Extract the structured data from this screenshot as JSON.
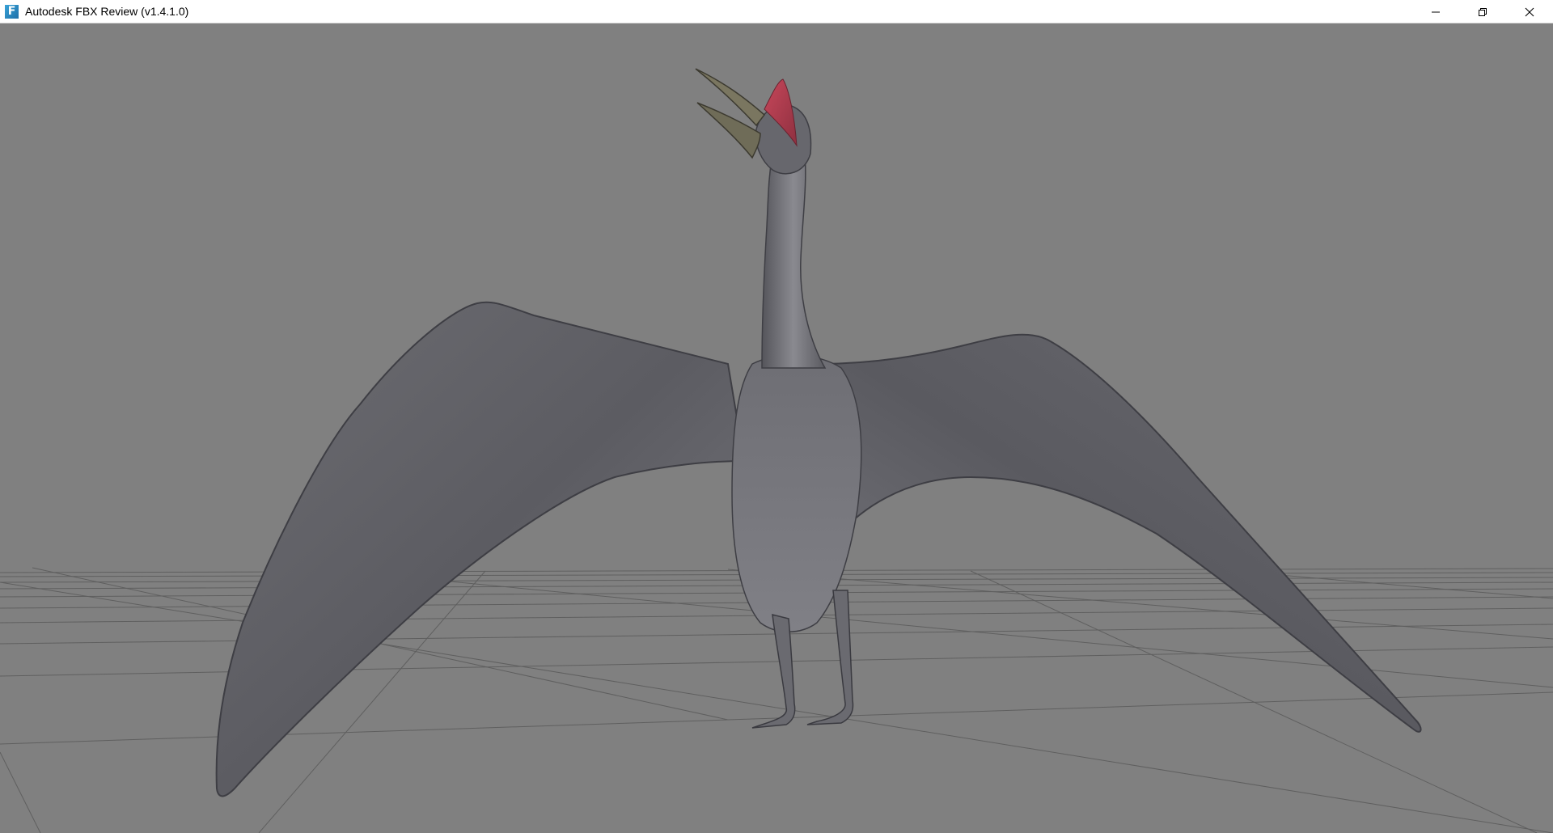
{
  "window": {
    "title": "Autodesk FBX Review (v1.4.1.0)",
    "app_icon_letter": "F",
    "app_icon": "fbx-review-app-icon",
    "controls": {
      "minimize_icon": "minimize-icon",
      "restore_icon": "restore-icon",
      "close_icon": "close-icon"
    }
  },
  "viewport": {
    "background_color": "#808080",
    "grid_color": "#5f5f5f",
    "model": "pterosaur"
  }
}
